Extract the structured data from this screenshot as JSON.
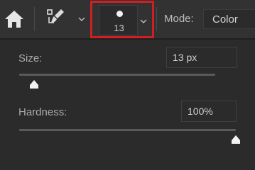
{
  "toolbar": {
    "home_icon": "home-icon",
    "tool_preset_icon": "brush-preset-icon",
    "brush_picker": {
      "size_label": "13",
      "highlight_color": "#d01f24"
    },
    "mode": {
      "label": "Mode:",
      "value": "Color"
    }
  },
  "panel": {
    "size": {
      "label": "Size:",
      "value": "13 px",
      "slider_fraction": 0.05
    },
    "hardness": {
      "label": "Hardness:",
      "value": "100%",
      "slider_fraction": 1.0
    }
  }
}
